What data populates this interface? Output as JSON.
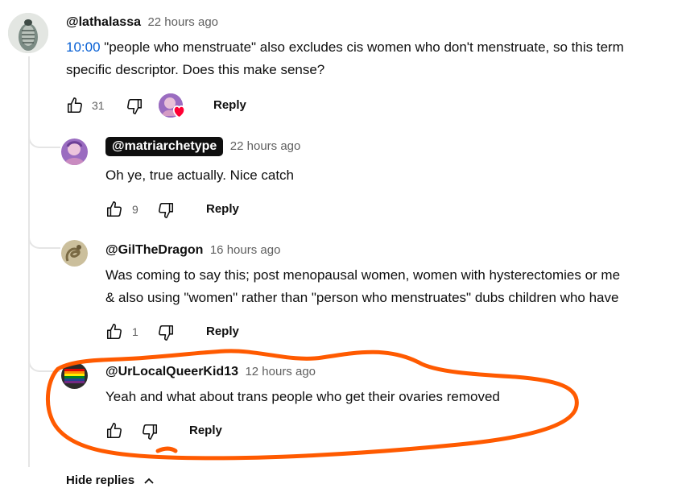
{
  "comments": [
    {
      "author": "@lathalassa",
      "time": "22 hours ago",
      "timestamp_link": "10:00",
      "text_line1": " \"people who menstruate\" also excludes cis women who don't menstruate, so this term",
      "text_line2": "specific descriptor. Does this make sense?",
      "likes": "31",
      "reply_label": "Reply"
    },
    {
      "author": "@matriarchetype",
      "time": "22 hours ago",
      "text_line1": "Oh ye, true actually. Nice catch",
      "likes": "9",
      "reply_label": "Reply"
    },
    {
      "author": "@GilTheDragon",
      "time": "16 hours ago",
      "text_line1": "Was coming to say this; post menopausal women, women with hysterectomies or me",
      "text_line2": "& also using \"women\" rather than \"person who menstruates\" dubs children who have",
      "likes": "1",
      "reply_label": "Reply"
    },
    {
      "author": "@UrLocalQueerKid13",
      "time": "12 hours ago",
      "text_line1": "Yeah and what about trans people who get their ovaries removed",
      "reply_label": "Reply"
    }
  ],
  "hide_replies_label": "Hide replies",
  "colors": {
    "link": "#065fd4",
    "highlight": "#ff5a00",
    "heart": "#ff0033"
  },
  "icons": [
    "thumbs-up-icon",
    "thumbs-down-icon",
    "heart-icon",
    "chevron-up-icon"
  ]
}
